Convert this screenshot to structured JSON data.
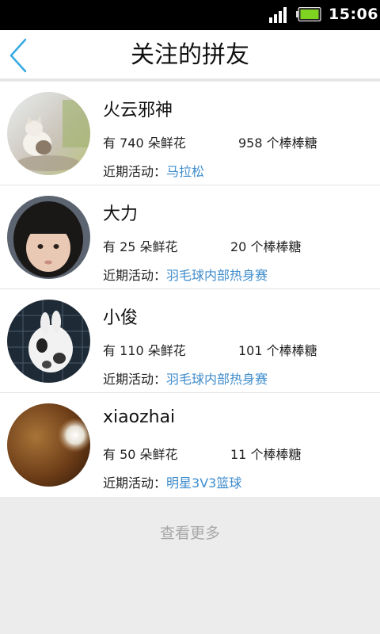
{
  "status_bar": {
    "time": "15:06",
    "signal_icon": "signal-icon",
    "battery_icon": "battery-icon"
  },
  "header": {
    "title": "关注的拼友",
    "back_icon": "back-arrow-icon"
  },
  "friends": [
    {
      "name": "火云邪神",
      "flowers": "有 740 朵鲜花",
      "lollipops": "958 个棒棒糖",
      "activity_label": "近期活动：",
      "activity": "马拉松"
    },
    {
      "name": "大力",
      "flowers": "有 25 朵鲜花",
      "lollipops": "20 个棒棒糖",
      "activity_label": "近期活动：",
      "activity": "羽毛球内部热身赛"
    },
    {
      "name": "小俊",
      "flowers": "有 110 朵鲜花",
      "lollipops": "101 个棒棒糖",
      "activity_label": "近期活动：",
      "activity": "羽毛球内部热身赛"
    },
    {
      "name": "xiaozhai",
      "flowers": "有 50 朵鲜花",
      "lollipops": "11 个棒棒糖",
      "activity_label": "近期活动：",
      "activity": "明星3V3篮球"
    }
  ],
  "more_label": "查看更多",
  "colors": {
    "link": "#3f8ccc",
    "accent": "#36a9e1",
    "battery": "#7ed321"
  }
}
